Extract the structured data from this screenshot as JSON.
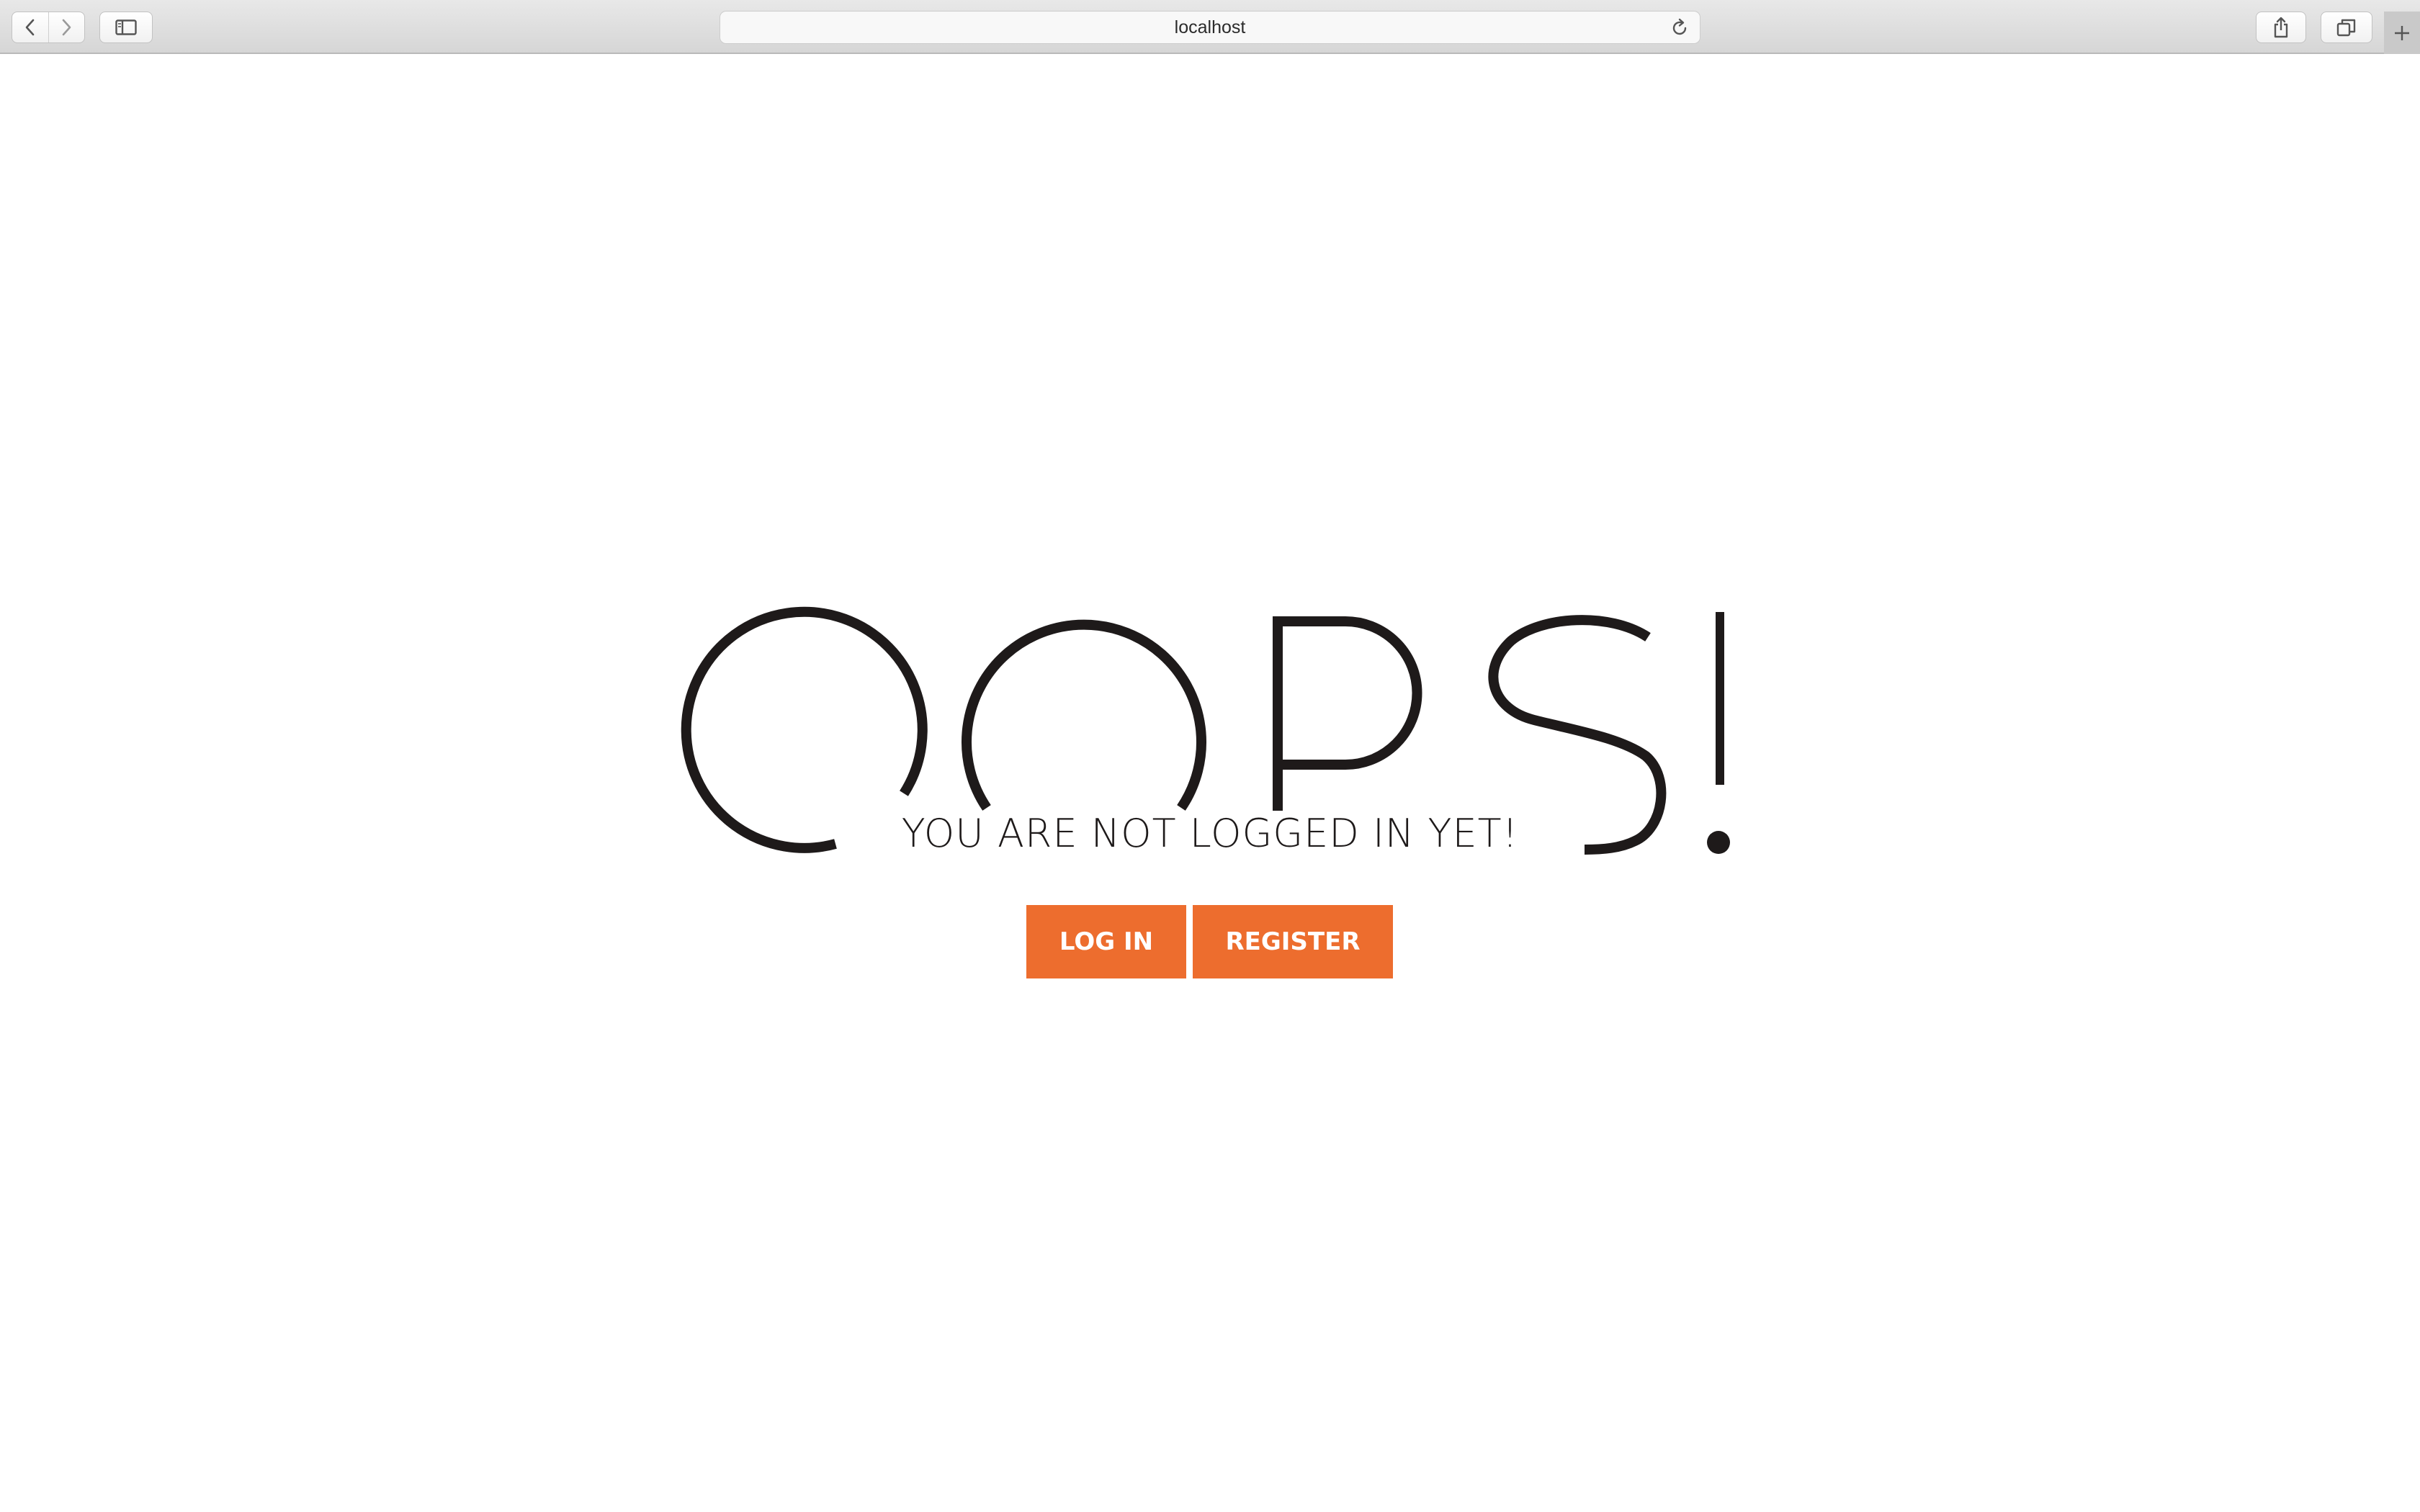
{
  "browser": {
    "url": "localhost",
    "icons": {
      "back": "chevron-left-icon",
      "forward": "chevron-right-icon",
      "sidebar": "sidebar-icon",
      "reload": "reload-icon",
      "share": "share-icon",
      "tabs": "tabs-icon",
      "new_tab": "plus-icon"
    }
  },
  "page": {
    "headline": "OOPS!",
    "message": "YOU ARE NOT LOGGED IN YET!",
    "login_label": "LOG IN",
    "register_label": "REGISTER"
  },
  "colors": {
    "accent": "#ed6d2e",
    "text": "#1e1a1a",
    "background": "#ffffff"
  }
}
